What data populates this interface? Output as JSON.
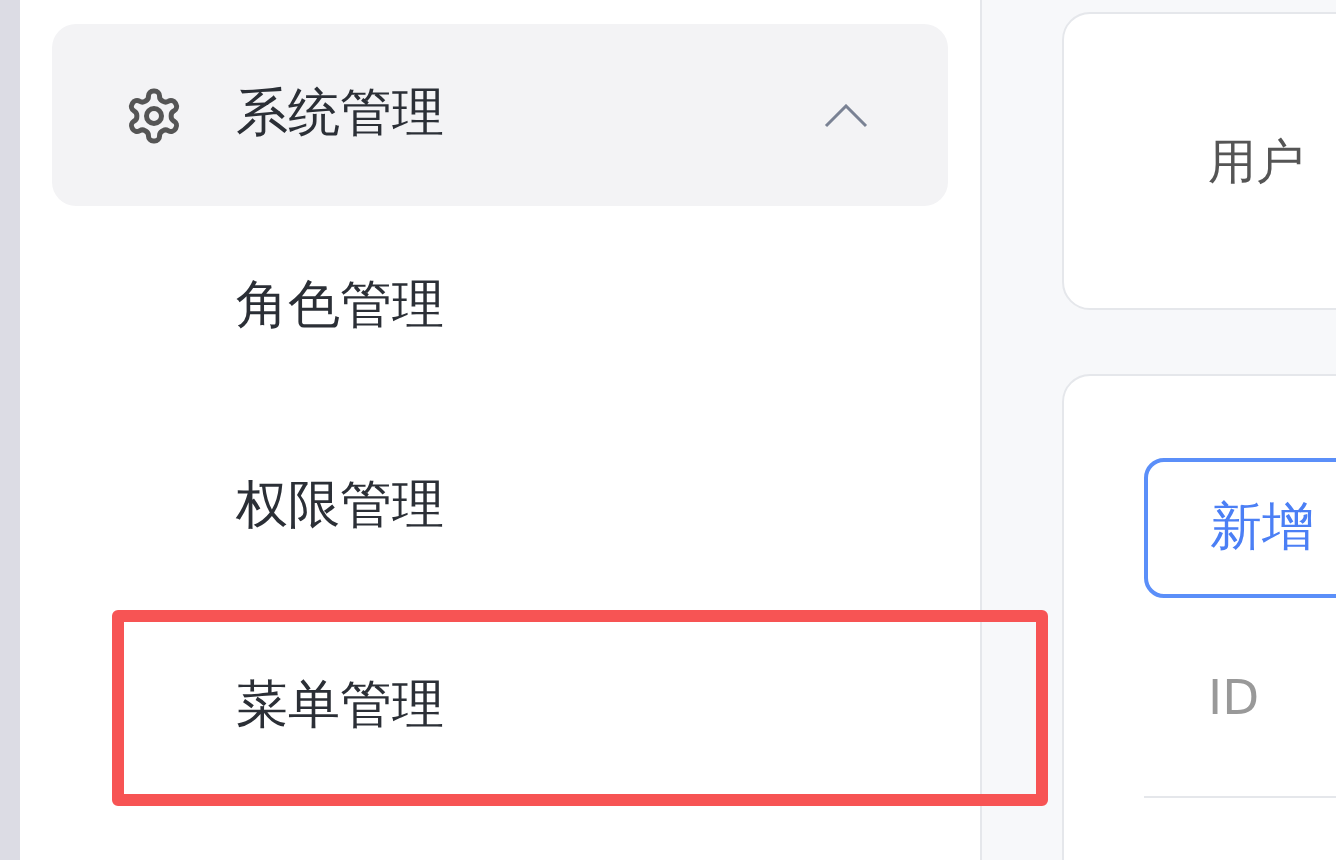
{
  "sidebar": {
    "group": {
      "label": "系统管理",
      "expanded": true,
      "selected": false
    },
    "items": [
      {
        "label": "角色管理",
        "selected": false,
        "highlighted": false
      },
      {
        "label": "权限管理",
        "selected": false,
        "highlighted": false
      },
      {
        "label": "菜单管理",
        "selected": false,
        "highlighted": true
      }
    ]
  },
  "filter_card": {
    "field_label": "用户"
  },
  "table_card": {
    "add_button": "新增",
    "columns": [
      "ID"
    ]
  }
}
